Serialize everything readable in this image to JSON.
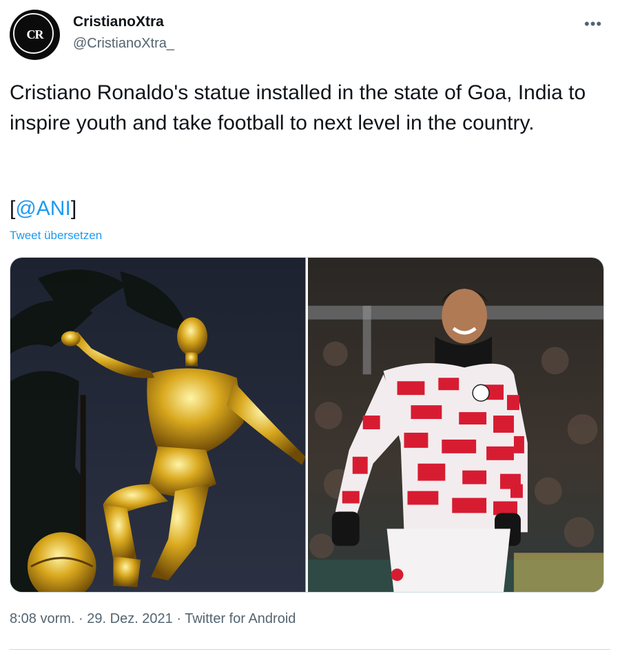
{
  "author": {
    "display_name": "CristianoXtra",
    "handle": "@CristianoXtra_",
    "avatar_text": "CR"
  },
  "tweet": {
    "text": "Cristiano Ronaldo's statue installed in the state of Goa, India to inspire youth and take football to next level in the country.",
    "mention_prefix": "[",
    "mention": "@ANI",
    "mention_suffix": "]",
    "translate_label": "Tweet übersetzen"
  },
  "more_icon": "more-dots-icon",
  "meta": {
    "time": "8:08 vorm.",
    "sep1": " · ",
    "date": "29. Dez. 2021",
    "sep2": " · ",
    "source": "Twitter for Android"
  },
  "colors": {
    "link": "#1d9bf0",
    "secondary": "#536471",
    "text": "#0f1419"
  }
}
